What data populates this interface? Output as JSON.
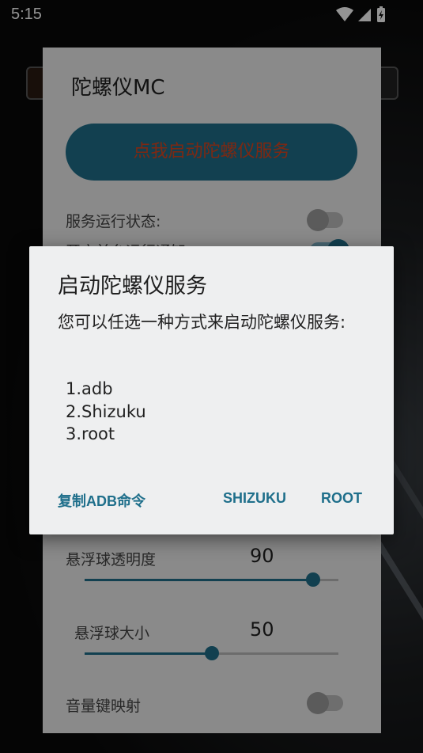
{
  "status_bar": {
    "time": "5:15",
    "icons": [
      "wifi-icon",
      "signal-icon",
      "battery-charging-icon"
    ]
  },
  "app": {
    "title": "陀螺仪MC",
    "start_button": "点我启动陀螺仪服务",
    "service_status_label": "服务运行状态:",
    "notification_label": "开启前台运行通知",
    "opacity_label": "悬浮球透明度",
    "opacity_value": "90",
    "opacity_fraction": 0.9,
    "size_label": "悬浮球大小",
    "size_value": "50",
    "size_fraction": 0.5,
    "volume_key_label": "音量键映射",
    "accent_color": "#1f6f8b"
  },
  "dialog": {
    "title": "启动陀螺仪服务",
    "message": "您可以任选一种方式来启动陀螺仪服务:",
    "options": [
      "1.adb",
      "2.Shizuku",
      "3.root"
    ],
    "btn_copy_adb": "复制ADB命令",
    "btn_shizuku": "SHIZUKU",
    "btn_root": "ROOT"
  }
}
